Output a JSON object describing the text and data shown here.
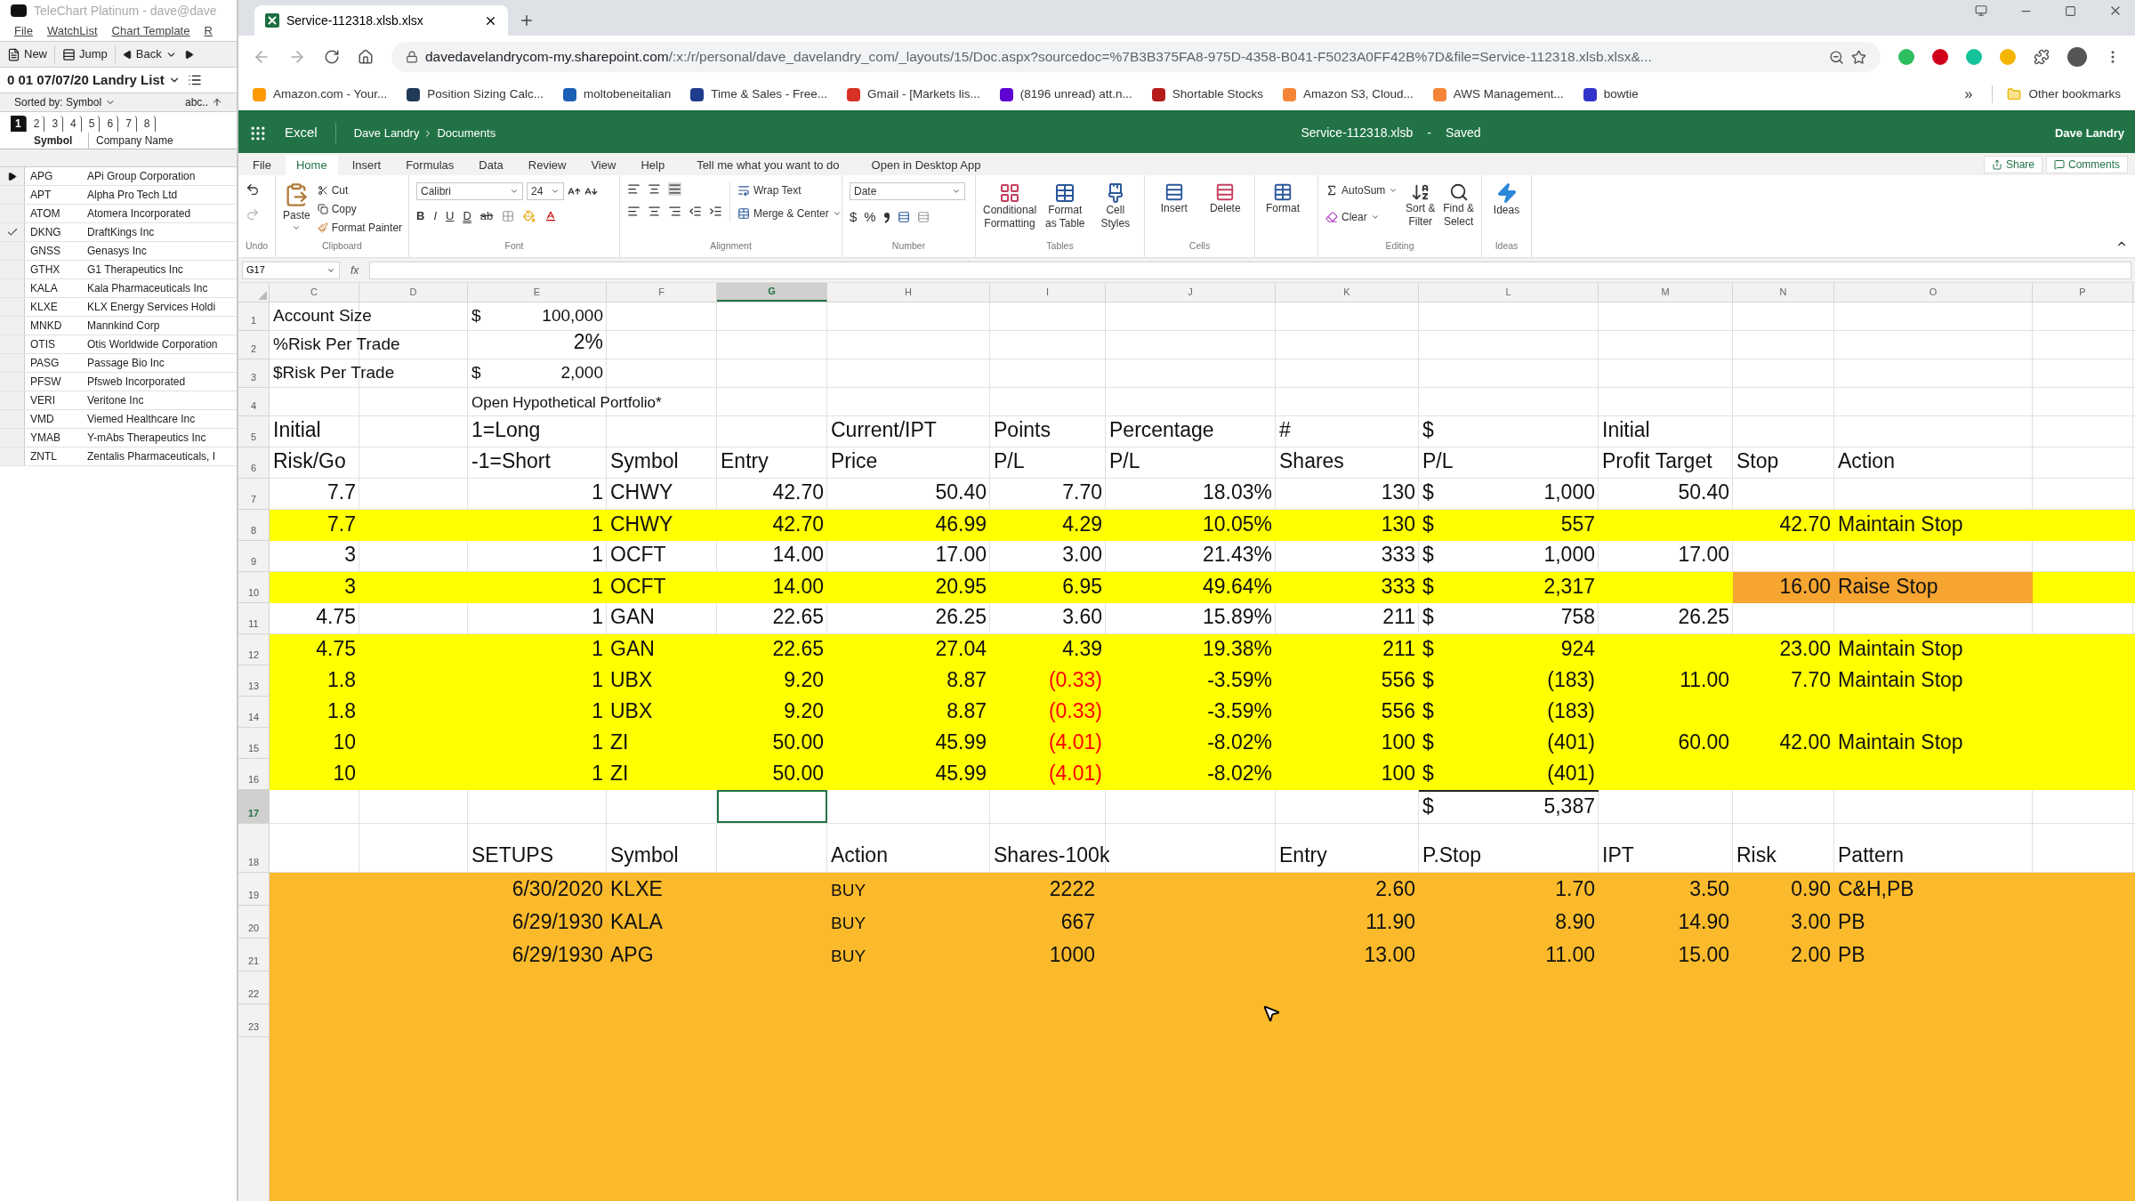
{
  "left_app": {
    "title": "TeleChart Platinum - dave@dave",
    "menu": [
      "File",
      "WatchList",
      "Chart Template",
      "R"
    ],
    "toolbar": {
      "new": "New",
      "jump": "Jump",
      "back": "Back"
    },
    "list_title": "0 01 07/07/20 Landry List",
    "sorted_by": "Sorted by: Symbol",
    "sort_label": "abc..",
    "tabs": [
      {
        "label": "1",
        "selected": true
      },
      {
        "label": "2",
        "selected": false
      },
      {
        "label": "3",
        "selected": false
      },
      {
        "label": "4",
        "selected": false
      },
      {
        "label": "5",
        "selected": false
      },
      {
        "label": "6",
        "selected": false
      },
      {
        "label": "7",
        "selected": false
      },
      {
        "label": "8",
        "selected": false
      }
    ],
    "columns": [
      "Symbol",
      "Company Name"
    ],
    "rows": [
      {
        "symbol": "APG",
        "name": "APi Group Corporation",
        "current": true,
        "checked": false
      },
      {
        "symbol": "APT",
        "name": "Alpha Pro Tech Ltd",
        "current": false,
        "checked": false
      },
      {
        "symbol": "ATOM",
        "name": "Atomera Incorporated",
        "current": false,
        "checked": false
      },
      {
        "symbol": "DKNG",
        "name": "DraftKings Inc",
        "current": false,
        "checked": true
      },
      {
        "symbol": "GNSS",
        "name": "Genasys Inc",
        "current": false,
        "checked": false
      },
      {
        "symbol": "GTHX",
        "name": "G1 Therapeutics Inc",
        "current": false,
        "checked": false
      },
      {
        "symbol": "KALA",
        "name": "Kala Pharmaceuticals Inc",
        "current": false,
        "checked": false
      },
      {
        "symbol": "KLXE",
        "name": "KLX Energy Services Holdi",
        "current": false,
        "checked": false
      },
      {
        "symbol": "MNKD",
        "name": "Mannkind Corp",
        "current": false,
        "checked": false
      },
      {
        "symbol": "OTIS",
        "name": "Otis Worldwide Corporation",
        "current": false,
        "checked": false
      },
      {
        "symbol": "PASG",
        "name": "Passage Bio Inc",
        "current": false,
        "checked": false
      },
      {
        "symbol": "PFSW",
        "name": "Pfsweb Incorporated",
        "current": false,
        "checked": false
      },
      {
        "symbol": "VERI",
        "name": "Veritone Inc",
        "current": false,
        "checked": false
      },
      {
        "symbol": "VMD",
        "name": "Viemed Healthcare Inc",
        "current": false,
        "checked": false
      },
      {
        "symbol": "YMAB",
        "name": "Y-mAbs Therapeutics Inc",
        "current": false,
        "checked": false
      },
      {
        "symbol": "ZNTL",
        "name": "Zentalis Pharmaceuticals, I",
        "current": false,
        "checked": false
      }
    ]
  },
  "browser": {
    "tab_title": "Service-112318.xlsb.xlsx",
    "url_host": "davedavelandrycom-my.sharepoint.com",
    "url_path": "/:x:/r/personal/dave_davelandry_com/_layouts/15/Doc.aspx?sourcedoc=%7B3B375FA8-975D-4358-B041-F5023A0FF42B%7D&file=Service-112318.xlsb.xlsx&...",
    "bookmarks": [
      {
        "label": "Amazon.com - Your...",
        "color": "#ff9900"
      },
      {
        "label": "Position Sizing Calc...",
        "color": "#1f3b57"
      },
      {
        "label": "moltobeneitalian",
        "color": "#1a5fb4"
      },
      {
        "label": "Time & Sales - Free...",
        "color": "#1f3b8c"
      },
      {
        "label": "Gmail - [Markets lis...",
        "color": "#d93025"
      },
      {
        "label": "(8196 unread) att.n...",
        "color": "#5f01d1"
      },
      {
        "label": "Shortable Stocks",
        "color": "#b71c1c"
      },
      {
        "label": "Amazon S3, Cloud...",
        "color": "#f58536"
      },
      {
        "label": "AWS Management...",
        "color": "#f58536"
      },
      {
        "label": "bowtie",
        "color": "#3333cc"
      }
    ],
    "more": "»",
    "other_bookmarks": "Other bookmarks",
    "extensions": [
      {
        "color": "#2dbe60"
      },
      {
        "color": "#d0021b"
      },
      {
        "color": "#15c39a"
      },
      {
        "color": "#f4b400"
      }
    ]
  },
  "excel": {
    "app": "Excel",
    "breadcrumb": [
      "Dave Landry",
      "Documents"
    ],
    "file_name": "Service-112318.xlsb",
    "separator": "-",
    "save_status": "Saved",
    "user": "Dave Landry",
    "ribbon_tabs": [
      {
        "label": "File",
        "selected": false
      },
      {
        "label": "Home",
        "selected": true
      },
      {
        "label": "Insert",
        "selected": false
      },
      {
        "label": "Formulas",
        "selected": false
      },
      {
        "label": "Data",
        "selected": false
      },
      {
        "label": "Review",
        "selected": false
      },
      {
        "label": "View",
        "selected": false
      },
      {
        "label": "Help",
        "selected": false
      }
    ],
    "tell_me": "Tell me what you want to do",
    "open_desktop": "Open in Desktop App",
    "share": "Share",
    "comments": "Comments",
    "ribbon": {
      "undo_group": "Undo",
      "clipboard": {
        "paste": "Paste",
        "cut": "Cut",
        "copy": "Copy",
        "format_painter": "Format Painter",
        "group": "Clipboard"
      },
      "font": {
        "family": "Calibri",
        "size": "24",
        "bold": "B",
        "italic": "I",
        "underline": "U",
        "double_underline": "D",
        "strike": "ab",
        "group": "Font"
      },
      "alignment": {
        "wrap_text": "Wrap Text",
        "merge": "Merge & Center",
        "group": "Alignment"
      },
      "number": {
        "format": "Date",
        "currency": "$",
        "percent": "%",
        "group": "Number"
      },
      "tables": {
        "conditional": "Conditional Formatting",
        "format_table": "Format as Table",
        "cell_styles": "Cell Styles",
        "group": "Tables"
      },
      "cells": {
        "insert": "Insert",
        "delete": "Delete",
        "format": "Format",
        "group": "Cells"
      },
      "editing": {
        "autosum": "AutoSum",
        "clear": "Clear",
        "sort": "Sort & Filter",
        "find": "Find & Select",
        "group": "Editing"
      },
      "ideas": {
        "ideas": "Ideas",
        "group": "Ideas"
      }
    },
    "name_box": "G17",
    "function_label": "fx",
    "columns": [
      {
        "letter": "C",
        "selected": false
      },
      {
        "letter": "D",
        "selected": false
      },
      {
        "letter": "E",
        "selected": false
      },
      {
        "letter": "F",
        "selected": false
      },
      {
        "letter": "G",
        "selected": true
      },
      {
        "letter": "H",
        "selected": false
      },
      {
        "letter": "I",
        "selected": false
      },
      {
        "letter": "J",
        "selected": false
      },
      {
        "letter": "K",
        "selected": false
      },
      {
        "letter": "L",
        "selected": false
      },
      {
        "letter": "M",
        "selected": false
      },
      {
        "letter": "N",
        "selected": false
      },
      {
        "letter": "O",
        "selected": false
      },
      {
        "letter": "P",
        "selected": false
      }
    ],
    "rows": [
      {
        "number": "1",
        "selected": false,
        "cells": {
          "C": {
            "kind": "label",
            "text": "Account Size"
          },
          "E": {
            "kind": "money",
            "currency": "$",
            "text": "100,000"
          }
        }
      },
      {
        "number": "2",
        "selected": false,
        "cells": {
          "C": {
            "kind": "label",
            "text": "%Risk Per Trade"
          },
          "E": {
            "kind": "num",
            "text": "2%"
          }
        }
      },
      {
        "number": "3",
        "selected": false,
        "cells": {
          "C": {
            "kind": "label",
            "text": "$Risk Per Trade"
          },
          "E": {
            "kind": "money",
            "currency": "$",
            "text": "2,000"
          }
        }
      },
      {
        "number": "4",
        "selected": false,
        "cells": {
          "E": {
            "kind": "note",
            "text": "Open Hypothetical Portfolio*"
          }
        }
      },
      {
        "number": "5",
        "selected": false,
        "cells": {
          "C": {
            "kind": "text",
            "text": "Initial"
          },
          "E": {
            "kind": "text",
            "text": "1=Long"
          },
          "H": {
            "kind": "text",
            "text": "Current/IPT"
          },
          "I": {
            "kind": "text",
            "text": "Points"
          },
          "J": {
            "kind": "text",
            "text": "Percentage"
          },
          "K": {
            "kind": "text",
            "text": "#"
          },
          "L": {
            "kind": "text",
            "text": "$"
          },
          "M": {
            "kind": "text",
            "text": "Initial"
          }
        }
      },
      {
        "number": "6",
        "selected": false,
        "cells": {
          "C": {
            "kind": "text",
            "text": "Risk/Go"
          },
          "E": {
            "kind": "text",
            "text": "-1=Short"
          },
          "F": {
            "kind": "text",
            "text": "Symbol"
          },
          "G": {
            "kind": "text",
            "text": "Entry"
          },
          "H": {
            "kind": "text",
            "text": "Price"
          },
          "I": {
            "kind": "text",
            "text": "P/L"
          },
          "J": {
            "kind": "text",
            "text": "P/L"
          },
          "K": {
            "kind": "text",
            "text": "Shares"
          },
          "L": {
            "kind": "text",
            "text": "P/L"
          },
          "M": {
            "kind": "text",
            "text": "Profit Target"
          },
          "N": {
            "kind": "text",
            "text": "Stop"
          },
          "O": {
            "kind": "text",
            "text": "Action"
          }
        }
      },
      {
        "number": "7",
        "selected": false,
        "cells": {
          "C": {
            "kind": "num",
            "text": "7.7"
          },
          "E": {
            "kind": "num",
            "text": "1"
          },
          "F": {
            "kind": "text",
            "text": "CHWY"
          },
          "G": {
            "kind": "num",
            "text": "42.70"
          },
          "H": {
            "kind": "num",
            "text": "50.40"
          },
          "I": {
            "kind": "num",
            "text": "7.70"
          },
          "J": {
            "kind": "num",
            "text": "18.03%"
          },
          "K": {
            "kind": "num",
            "text": "130"
          },
          "L": {
            "kind": "money",
            "currency": "$",
            "text": "1,000"
          },
          "M": {
            "kind": "num",
            "text": "50.40"
          }
        }
      },
      {
        "number": "8",
        "selected": false,
        "color": "#ffff00",
        "cells": {
          "C": {
            "kind": "num",
            "text": "7.7"
          },
          "E": {
            "kind": "num",
            "text": "1"
          },
          "F": {
            "kind": "text",
            "text": "CHWY"
          },
          "G": {
            "kind": "num",
            "text": "42.70"
          },
          "H": {
            "kind": "num",
            "text": "46.99"
          },
          "I": {
            "kind": "num",
            "text": "4.29"
          },
          "J": {
            "kind": "num",
            "text": "10.05%"
          },
          "K": {
            "kind": "num",
            "text": "130"
          },
          "L": {
            "kind": "money",
            "currency": "$",
            "text": "557"
          },
          "N": {
            "kind": "num",
            "text": "42.70"
          },
          "O": {
            "kind": "text",
            "text": "Maintain Stop"
          }
        }
      },
      {
        "number": "9",
        "selected": false,
        "cells": {
          "C": {
            "kind": "num",
            "text": "3"
          },
          "E": {
            "kind": "num",
            "text": "1"
          },
          "F": {
            "kind": "text",
            "text": "OCFT"
          },
          "G": {
            "kind": "num",
            "text": "14.00"
          },
          "H": {
            "kind": "num",
            "text": "17.00"
          },
          "I": {
            "kind": "num",
            "text": "3.00"
          },
          "J": {
            "kind": "num",
            "text": "21.43%"
          },
          "K": {
            "kind": "num",
            "text": "333"
          },
          "L": {
            "kind": "money",
            "currency": "$",
            "text": "1,000"
          },
          "M": {
            "kind": "num",
            "text": "17.00"
          }
        }
      },
      {
        "number": "10",
        "selected": false,
        "color": "#ffff00",
        "cells": {
          "C": {
            "kind": "num",
            "text": "3"
          },
          "E": {
            "kind": "num",
            "text": "1"
          },
          "F": {
            "kind": "text",
            "text": "OCFT"
          },
          "G": {
            "kind": "num",
            "text": "14.00"
          },
          "H": {
            "kind": "num",
            "text": "20.95"
          },
          "I": {
            "kind": "num",
            "text": "6.95"
          },
          "J": {
            "kind": "num",
            "text": "49.64%"
          },
          "K": {
            "kind": "num",
            "text": "333"
          },
          "L": {
            "kind": "money",
            "currency": "$",
            "text": "2,317"
          },
          "N": {
            "kind": "num",
            "text": "16.00",
            "color": "#f6a531"
          },
          "O": {
            "kind": "text",
            "text": "Raise Stop",
            "color": "#f6a531"
          }
        }
      },
      {
        "number": "11",
        "selected": false,
        "cells": {
          "C": {
            "kind": "num",
            "text": "4.75"
          },
          "E": {
            "kind": "num",
            "text": "1"
          },
          "F": {
            "kind": "text",
            "text": "GAN"
          },
          "G": {
            "kind": "num",
            "text": "22.65"
          },
          "H": {
            "kind": "num",
            "text": "26.25"
          },
          "I": {
            "kind": "num",
            "text": "3.60"
          },
          "J": {
            "kind": "num",
            "text": "15.89%"
          },
          "K": {
            "kind": "num",
            "text": "211"
          },
          "L": {
            "kind": "money",
            "currency": "$",
            "text": "758"
          },
          "M": {
            "kind": "num",
            "text": "26.25"
          }
        }
      },
      {
        "number": "12",
        "selected": false,
        "color": "#ffff00",
        "cells": {
          "C": {
            "kind": "num",
            "text": "4.75"
          },
          "E": {
            "kind": "num",
            "text": "1"
          },
          "F": {
            "kind": "text",
            "text": "GAN"
          },
          "G": {
            "kind": "num",
            "text": "22.65"
          },
          "H": {
            "kind": "num",
            "text": "27.04"
          },
          "I": {
            "kind": "num",
            "text": "4.39"
          },
          "J": {
            "kind": "num",
            "text": "19.38%"
          },
          "K": {
            "kind": "num",
            "text": "211"
          },
          "L": {
            "kind": "money",
            "currency": "$",
            "text": "924"
          },
          "N": {
            "kind": "num",
            "text": "23.00"
          },
          "O": {
            "kind": "text",
            "text": "Maintain Stop"
          }
        }
      },
      {
        "number": "13",
        "selected": false,
        "color": "#ffff00",
        "cells": {
          "C": {
            "kind": "num",
            "text": "1.8"
          },
          "E": {
            "kind": "num",
            "text": "1"
          },
          "F": {
            "kind": "text",
            "text": "UBX"
          },
          "G": {
            "kind": "num",
            "text": "9.20"
          },
          "H": {
            "kind": "num",
            "text": "8.87"
          },
          "I": {
            "kind": "neg",
            "text": "(0.33)"
          },
          "J": {
            "kind": "num",
            "text": "-3.59%"
          },
          "K": {
            "kind": "num",
            "text": "556"
          },
          "L": {
            "kind": "money",
            "currency": "$",
            "text": "(183)"
          },
          "M": {
            "kind": "num",
            "text": "11.00"
          },
          "N": {
            "kind": "num",
            "text": "7.70"
          },
          "O": {
            "kind": "text",
            "text": "Maintain Stop"
          }
        }
      },
      {
        "number": "14",
        "selected": false,
        "color": "#ffff00",
        "cells": {
          "C": {
            "kind": "num",
            "text": "1.8"
          },
          "E": {
            "kind": "num",
            "text": "1"
          },
          "F": {
            "kind": "text",
            "text": "UBX"
          },
          "G": {
            "kind": "num",
            "text": "9.20"
          },
          "H": {
            "kind": "num",
            "text": "8.87"
          },
          "I": {
            "kind": "neg",
            "text": "(0.33)"
          },
          "J": {
            "kind": "num",
            "text": "-3.59%"
          },
          "K": {
            "kind": "num",
            "text": "556"
          },
          "L": {
            "kind": "money",
            "currency": "$",
            "text": "(183)"
          }
        }
      },
      {
        "number": "15",
        "selected": false,
        "color": "#ffff00",
        "cells": {
          "C": {
            "kind": "num",
            "text": "10"
          },
          "E": {
            "kind": "num",
            "text": "1"
          },
          "F": {
            "kind": "text",
            "text": "ZI"
          },
          "G": {
            "kind": "num",
            "text": "50.00"
          },
          "H": {
            "kind": "num",
            "text": "45.99"
          },
          "I": {
            "kind": "neg",
            "text": "(4.01)"
          },
          "J": {
            "kind": "num",
            "text": "-8.02%"
          },
          "K": {
            "kind": "num",
            "text": "100"
          },
          "L": {
            "kind": "money",
            "currency": "$",
            "text": "(401)"
          },
          "M": {
            "kind": "num",
            "text": "60.00"
          },
          "N": {
            "kind": "num",
            "text": "42.00"
          },
          "O": {
            "kind": "text",
            "text": "Maintain Stop"
          }
        }
      },
      {
        "number": "16",
        "selected": false,
        "color": "#ffff00",
        "cells": {
          "C": {
            "kind": "num",
            "text": "10"
          },
          "E": {
            "kind": "num",
            "text": "1"
          },
          "F": {
            "kind": "text",
            "text": "ZI"
          },
          "G": {
            "kind": "num",
            "text": "50.00"
          },
          "H": {
            "kind": "num",
            "text": "45.99"
          },
          "I": {
            "kind": "neg",
            "text": "(4.01)"
          },
          "J": {
            "kind": "num",
            "text": "-8.02%"
          },
          "K": {
            "kind": "num",
            "text": "100"
          },
          "L": {
            "kind": "money",
            "currency": "$",
            "text": "(401)"
          }
        }
      },
      {
        "number": "17",
        "selected": true,
        "cells": {
          "L": {
            "kind": "total",
            "currency": "$",
            "text": "5,387"
          }
        }
      },
      {
        "number": "18",
        "selected": false,
        "cells": {
          "E": {
            "kind": "text",
            "text": "SETUPS"
          },
          "F": {
            "kind": "text",
            "text": "Symbol"
          },
          "H": {
            "kind": "text",
            "text": "Action"
          },
          "I": {
            "kind": "text",
            "text": "Shares-100k"
          },
          "K": {
            "kind": "text",
            "text": "Entry"
          },
          "L": {
            "kind": "text",
            "text": "P.Stop"
          },
          "M": {
            "kind": "text",
            "text": "IPT"
          },
          "N": {
            "kind": "text",
            "text": "Risk"
          },
          "O": {
            "kind": "text",
            "text": "Pattern"
          }
        }
      },
      {
        "number": "19",
        "selected": false,
        "color": "#fbba2b",
        "cells": {
          "E": {
            "kind": "num",
            "text": "6/30/2020"
          },
          "F": {
            "kind": "text",
            "text": "KLXE"
          },
          "H": {
            "kind": "small",
            "text": "BUY"
          },
          "I": {
            "kind": "center",
            "text": "2222"
          },
          "K": {
            "kind": "num",
            "text": "2.60"
          },
          "L": {
            "kind": "num",
            "text": "1.70"
          },
          "M": {
            "kind": "num",
            "text": "3.50"
          },
          "N": {
            "kind": "num",
            "text": "0.90"
          },
          "O": {
            "kind": "text",
            "text": "C&H,PB"
          }
        }
      },
      {
        "number": "20",
        "selected": false,
        "color": "#fbba2b",
        "cells": {
          "E": {
            "kind": "num",
            "text": "6/29/1930"
          },
          "F": {
            "kind": "text",
            "text": "KALA"
          },
          "H": {
            "kind": "small",
            "text": "BUY"
          },
          "I": {
            "kind": "center",
            "text": "667"
          },
          "K": {
            "kind": "num",
            "text": "11.90"
          },
          "L": {
            "kind": "num",
            "text": "8.90"
          },
          "M": {
            "kind": "num",
            "text": "14.90"
          },
          "N": {
            "kind": "num",
            "text": "3.00"
          },
          "O": {
            "kind": "text",
            "text": "PB"
          }
        }
      },
      {
        "number": "21",
        "selected": false,
        "color": "#fbba2b",
        "cells": {
          "E": {
            "kind": "num",
            "text": "6/29/1930"
          },
          "F": {
            "kind": "text",
            "text": "APG"
          },
          "H": {
            "kind": "small",
            "text": "BUY"
          },
          "I": {
            "kind": "center",
            "text": "1000"
          },
          "K": {
            "kind": "num",
            "text": "13.00"
          },
          "L": {
            "kind": "num",
            "text": "11.00"
          },
          "M": {
            "kind": "num",
            "text": "15.00"
          },
          "N": {
            "kind": "num",
            "text": "2.00"
          },
          "O": {
            "kind": "text",
            "text": "PB"
          }
        }
      },
      {
        "number": "22",
        "selected": false,
        "color": "#fbba2b"
      },
      {
        "number": "23",
        "selected": false,
        "color": "#fbba2b"
      }
    ]
  }
}
